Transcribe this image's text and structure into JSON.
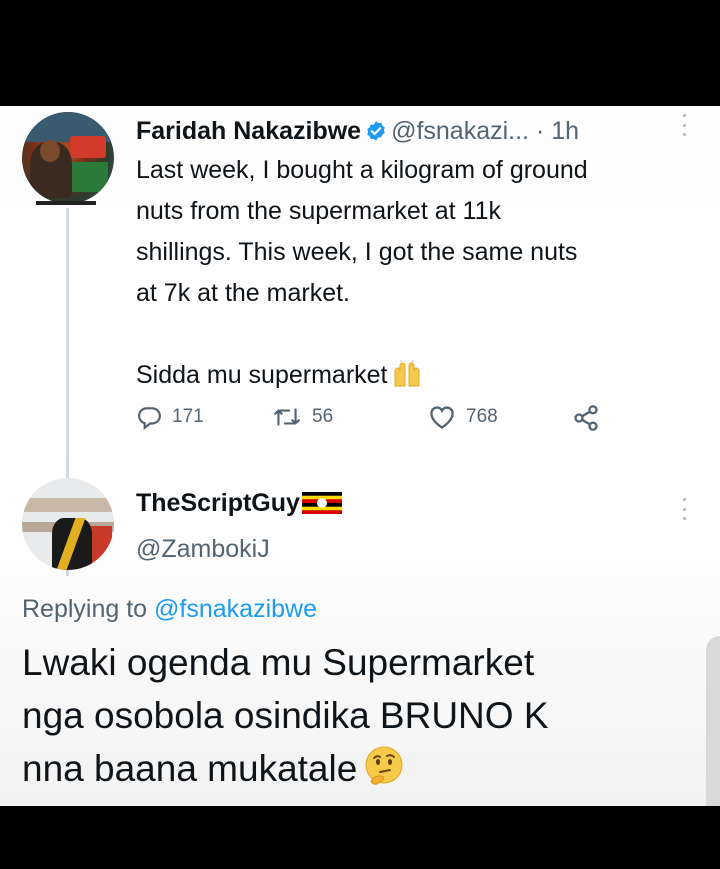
{
  "tweet1": {
    "display_name": "Faridah Nakazibwe",
    "handle": "@fsnakazi...",
    "separator": "·",
    "time": "1h",
    "body_lines": [
      "Last week, I bought a kilogram of ground",
      "nuts from the supermarket at 11k",
      "shillings. This week, I got the same nuts",
      "at 7k at the market."
    ],
    "closing_line": "Sidda mu supermarket",
    "actions": {
      "replies": "171",
      "retweets": "56",
      "likes": "768"
    }
  },
  "tweet2": {
    "display_name": "TheScriptGuy",
    "handle": "@ZambokiJ",
    "replying_prefix": "Replying to",
    "replying_mention": "@fsnakazibwe",
    "body_lines": [
      "Lwaki ogenda mu Supermarket",
      "nga osobola osindika BRUNO K",
      "nna baana mukatale"
    ]
  },
  "icons": {
    "verified": "verified-badge-icon",
    "reply": "reply-icon",
    "retweet": "retweet-icon",
    "like": "heart-icon",
    "share": "share-icon",
    "more": "more-vertical-icon",
    "hands": "raising-hands-emoji",
    "thinking": "thinking-face-emoji",
    "flag": "uganda-flag-emoji"
  },
  "colors": {
    "text_primary": "#0f1419",
    "text_secondary": "#536471",
    "link": "#1d9bf0",
    "verified": "#1d9bf0",
    "thread_line": "#cfd9de"
  }
}
